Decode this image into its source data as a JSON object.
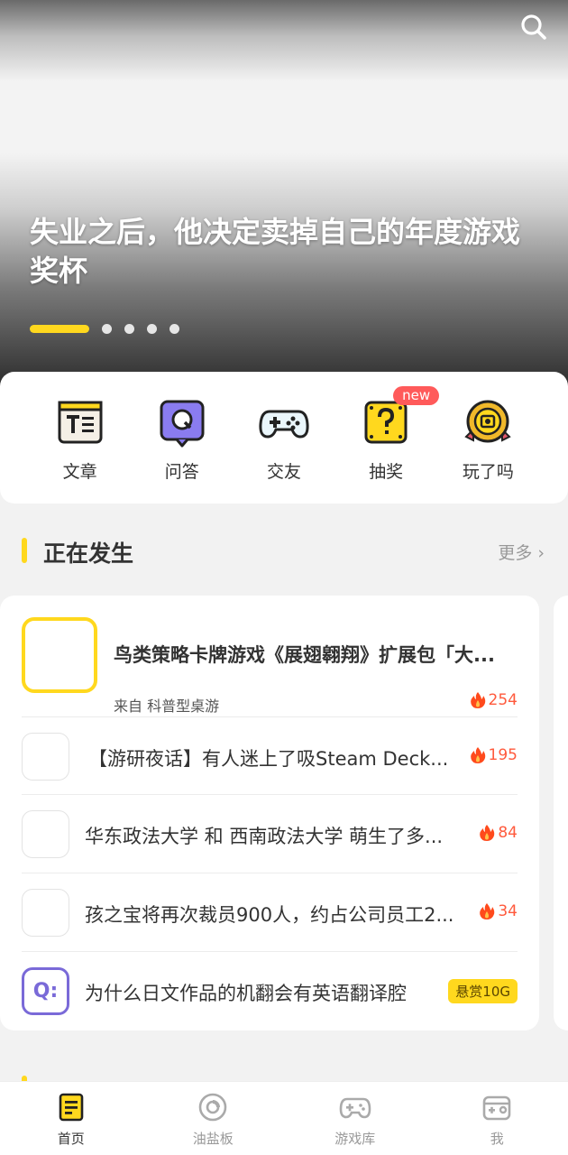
{
  "hero": {
    "title": "失业之后，他决定卖掉自己的年度游戏奖杯",
    "dot_count": 5,
    "active_dot": 1
  },
  "quick_menu": [
    {
      "label": "文章",
      "icon": "article-icon"
    },
    {
      "label": "问答",
      "icon": "qa-icon"
    },
    {
      "label": "交友",
      "icon": "gamepad-icon"
    },
    {
      "label": "抽奖",
      "icon": "lottery-icon",
      "badge": "new"
    },
    {
      "label": "玩了吗",
      "icon": "played-icon"
    }
  ],
  "section": {
    "title": "正在发生",
    "more": "更多"
  },
  "news": {
    "featured": {
      "title": "鸟类策略卡牌游戏《展翅翱翔》扩展包「大...",
      "source": "来自  科普型桌游",
      "heat": "254"
    },
    "rows": [
      {
        "title": "【游研夜话】有人迷上了吸Steam Deck...",
        "heat": "195"
      },
      {
        "title": "华东政法大学 和 西南政法大学 萌生了多...",
        "heat": "84"
      },
      {
        "title": "孩之宝将再次裁员900人，约占公司员工2...",
        "heat": "34"
      }
    ],
    "question": {
      "title": "为什么日文作品的机翻会有英语翻译腔",
      "reward": "悬赏10G",
      "icon_text": "Q:"
    }
  },
  "bottom_nav": [
    {
      "label": "首页",
      "icon": "home-icon",
      "active": true
    },
    {
      "label": "油盐板",
      "icon": "board-icon",
      "active": false
    },
    {
      "label": "游戏库",
      "icon": "game-library-icon",
      "active": false
    },
    {
      "label": "我",
      "icon": "profile-icon",
      "active": false
    }
  ],
  "colors": {
    "accent": "#ffd81e",
    "hot": "#ff5a3d",
    "question": "#7a6ad8",
    "badge": "#ff5a5a"
  }
}
